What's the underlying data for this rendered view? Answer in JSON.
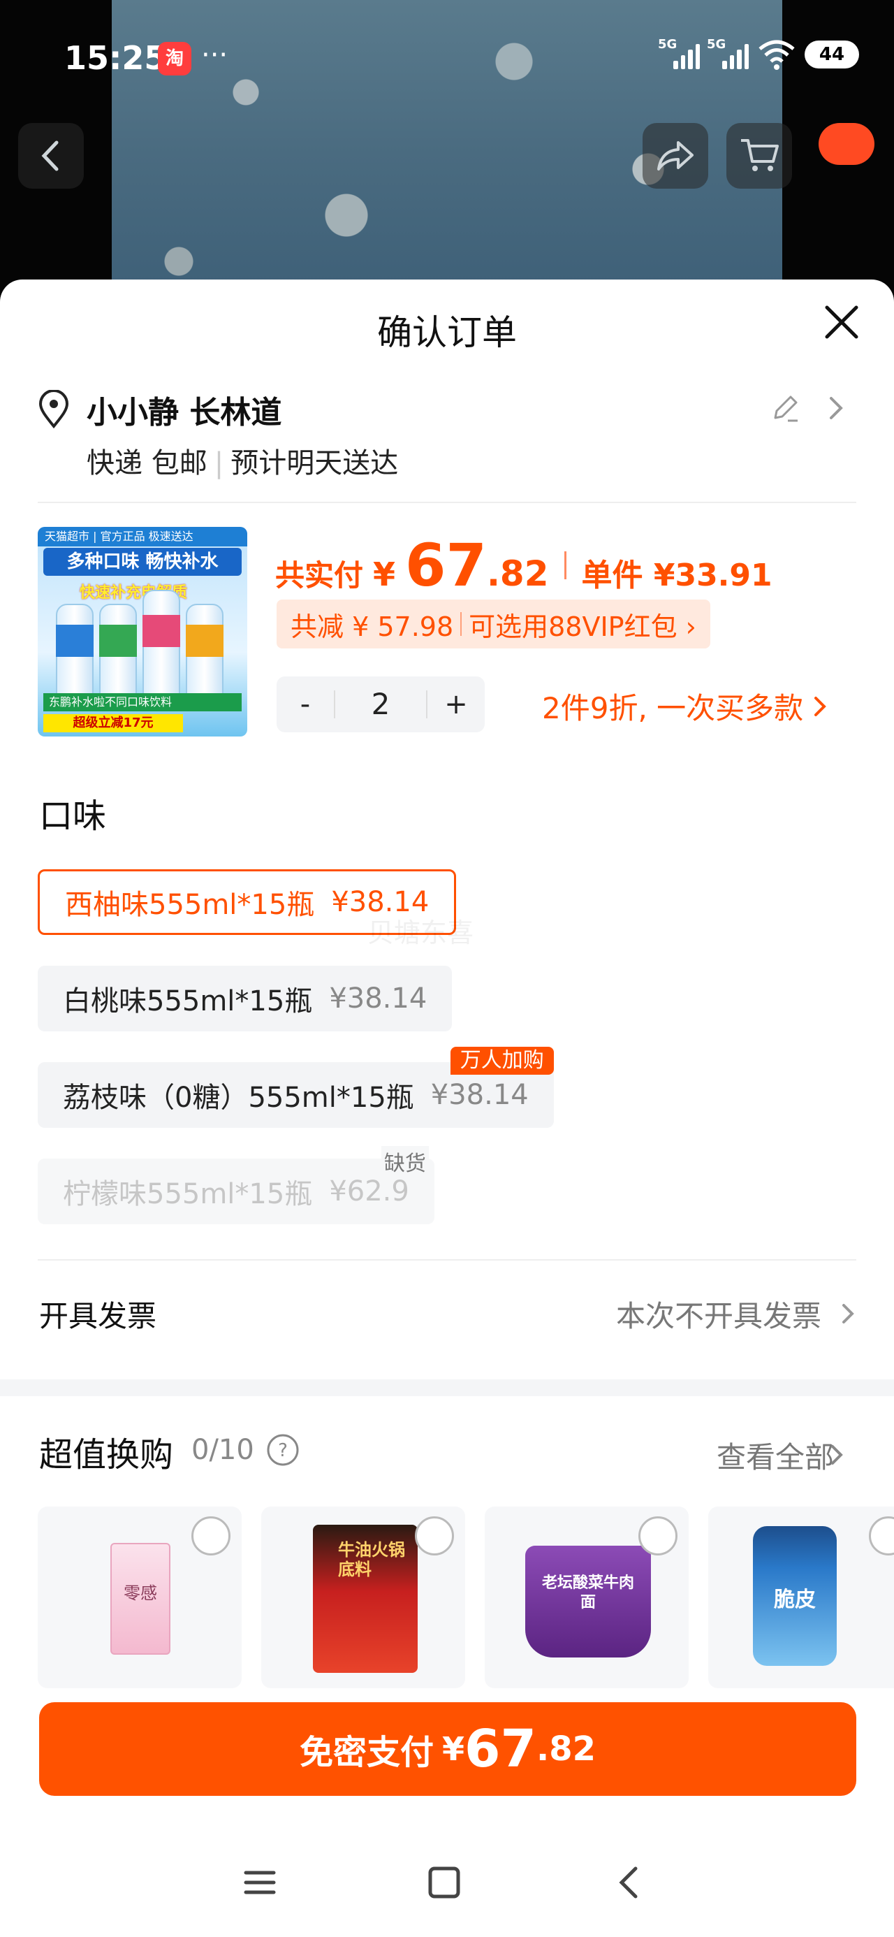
{
  "status_bar": {
    "time": "15:25",
    "app_icon_text": "淘",
    "more": "···",
    "sim1": "5G",
    "sim2": "5G",
    "battery": "44"
  },
  "sheet": {
    "title": "确认订单",
    "address": {
      "name": "小小静 长林道",
      "shipping": "快递 包邮",
      "eta": "预计明天送达"
    },
    "product": {
      "image_top_text": "天猫超市 | 官方正品 极速送达",
      "image_title": "多种口味 畅快补水",
      "image_subtitle": "快速补充电解质",
      "image_green_text": "东鹏补水啦不同口味饮料",
      "image_save_text": "超级立减17元",
      "price_label": "共实付",
      "price_yen": "¥",
      "price_int": "67",
      "price_dec": ".82",
      "unit_price": "单件 ¥33.91",
      "discount_text": "共减 ¥ 57.98",
      "vip_text": "可选用88VIP红包 ›",
      "quantity": "2",
      "minus": "-",
      "plus": "+",
      "promo_text": "2件9折, 一次买多款"
    },
    "flavor_title": "口味",
    "options": [
      {
        "label": "西柚味555ml*15瓶",
        "price": "¥38.14",
        "state": "selected"
      },
      {
        "label": "白桃味555ml*15瓶",
        "price": "¥38.14",
        "state": "normal"
      },
      {
        "label": "荔枝味（0糖）555ml*15瓶",
        "price": "¥38.14",
        "state": "normal",
        "badge": "万人加购"
      },
      {
        "label": "柠檬味555ml*15瓶",
        "price": "¥62.9",
        "state": "disabled",
        "badge": "缺货"
      }
    ],
    "watermark": "贝塘东喜",
    "invoice": {
      "label": "开具发票",
      "value": "本次不开具发票"
    },
    "upsell": {
      "title": "超值换购",
      "count": "0/10",
      "view_all": "查看全部",
      "items": [
        {
          "name": "零感",
          "icon": "tea-box-icon",
          "color": "#f6c7d8"
        },
        {
          "name": "牛油火锅底料",
          "icon": "hotpot-pack-icon",
          "color": "#c7201f"
        },
        {
          "name": "老坛酸菜牛肉面",
          "icon": "noodle-cup-icon",
          "color": "#7a3f9e"
        },
        {
          "name": "脆皮",
          "icon": "gum-jar-icon",
          "color": "#2a79c9"
        }
      ]
    },
    "pay": {
      "label": "免密支付",
      "yen": "¥",
      "int": "67",
      "dec": ".82"
    }
  },
  "colors": {
    "accent": "#ff5000",
    "pill_bg": "#ffe9de",
    "option_bg": "#f3f4f6"
  }
}
